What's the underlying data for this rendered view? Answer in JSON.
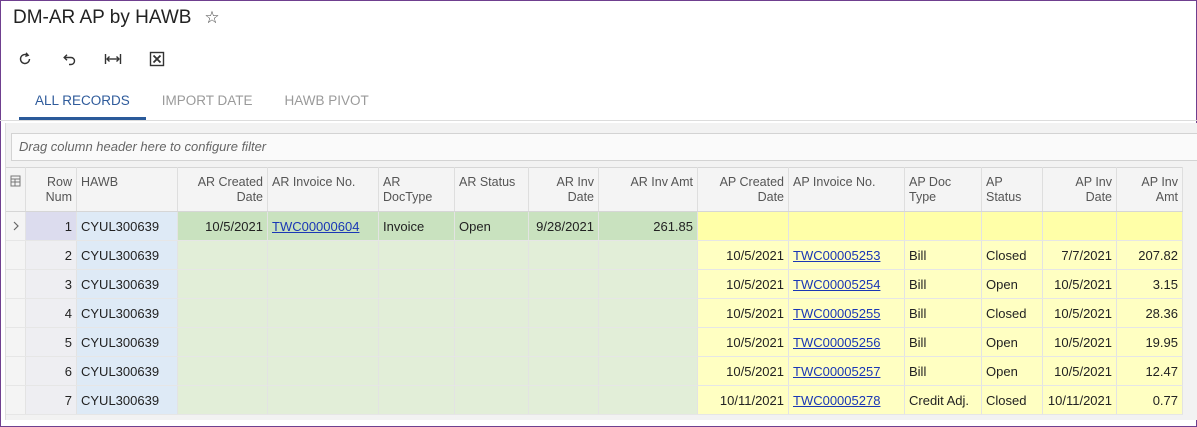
{
  "page": {
    "title": "DM-AR AP by HAWB",
    "favorite_icon": "star-icon"
  },
  "toolbar": {
    "buttons": [
      {
        "name": "refresh-button",
        "icon": "refresh-icon"
      },
      {
        "name": "undo-button",
        "icon": "undo-icon"
      },
      {
        "name": "fit-columns-button",
        "icon": "fit-width-icon"
      },
      {
        "name": "export-excel-button",
        "icon": "excel-icon"
      }
    ]
  },
  "tabs": [
    {
      "label": "ALL RECORDS",
      "active": true
    },
    {
      "label": "IMPORT DATE",
      "active": false
    },
    {
      "label": "HAWB PIVOT",
      "active": false
    }
  ],
  "grid": {
    "filter_placeholder": "Drag column header here to configure filter",
    "columns": {
      "row_num": "Row Num",
      "hawb": "HAWB",
      "ar_created_date": "AR Created Date",
      "ar_invoice_no": "AR Invoice No.",
      "ar_doctype": "AR DocType",
      "ar_status": "AR Status",
      "ar_inv_date": "AR Inv Date",
      "ar_inv_amt": "AR Inv Amt",
      "ap_created_date": "AP Created Date",
      "ap_invoice_no": "AP Invoice No.",
      "ap_doc_type": "AP Doc Type",
      "ap_status": "AP Status",
      "ap_inv_date": "AP Inv Date",
      "ap_inv_amt": "AP Inv Amt"
    },
    "rows": [
      {
        "row_num": "1",
        "hawb": "CYUL300639",
        "ar_created_date": "10/5/2021",
        "ar_invoice_no": "TWC00000604",
        "ar_doctype": "Invoice",
        "ar_status": "Open",
        "ar_inv_date": "9/28/2021",
        "ar_inv_amt": "261.85",
        "ap_created_date": "",
        "ap_invoice_no": "",
        "ap_doc_type": "",
        "ap_status": "",
        "ap_inv_date": "",
        "ap_inv_amt": "",
        "selected": true
      },
      {
        "row_num": "2",
        "hawb": "CYUL300639",
        "ar_created_date": "",
        "ar_invoice_no": "",
        "ar_doctype": "",
        "ar_status": "",
        "ar_inv_date": "",
        "ar_inv_amt": "",
        "ap_created_date": "10/5/2021",
        "ap_invoice_no": "TWC00005253",
        "ap_doc_type": "Bill",
        "ap_status": "Closed",
        "ap_inv_date": "7/7/2021",
        "ap_inv_amt": "207.82"
      },
      {
        "row_num": "3",
        "hawb": "CYUL300639",
        "ar_created_date": "",
        "ar_invoice_no": "",
        "ar_doctype": "",
        "ar_status": "",
        "ar_inv_date": "",
        "ar_inv_amt": "",
        "ap_created_date": "10/5/2021",
        "ap_invoice_no": "TWC00005254",
        "ap_doc_type": "Bill",
        "ap_status": "Open",
        "ap_inv_date": "10/5/2021",
        "ap_inv_amt": "3.15"
      },
      {
        "row_num": "4",
        "hawb": "CYUL300639",
        "ar_created_date": "",
        "ar_invoice_no": "",
        "ar_doctype": "",
        "ar_status": "",
        "ar_inv_date": "",
        "ar_inv_amt": "",
        "ap_created_date": "10/5/2021",
        "ap_invoice_no": "TWC00005255",
        "ap_doc_type": "Bill",
        "ap_status": "Closed",
        "ap_inv_date": "10/5/2021",
        "ap_inv_amt": "28.36"
      },
      {
        "row_num": "5",
        "hawb": "CYUL300639",
        "ar_created_date": "",
        "ar_invoice_no": "",
        "ar_doctype": "",
        "ar_status": "",
        "ar_inv_date": "",
        "ar_inv_amt": "",
        "ap_created_date": "10/5/2021",
        "ap_invoice_no": "TWC00005256",
        "ap_doc_type": "Bill",
        "ap_status": "Open",
        "ap_inv_date": "10/5/2021",
        "ap_inv_amt": "19.95"
      },
      {
        "row_num": "6",
        "hawb": "CYUL300639",
        "ar_created_date": "",
        "ar_invoice_no": "",
        "ar_doctype": "",
        "ar_status": "",
        "ar_inv_date": "",
        "ar_inv_amt": "",
        "ap_created_date": "10/5/2021",
        "ap_invoice_no": "TWC00005257",
        "ap_doc_type": "Bill",
        "ap_status": "Open",
        "ap_inv_date": "10/5/2021",
        "ap_inv_amt": "12.47"
      },
      {
        "row_num": "7",
        "hawb": "CYUL300639",
        "ar_created_date": "",
        "ar_invoice_no": "",
        "ar_doctype": "",
        "ar_status": "",
        "ar_inv_date": "",
        "ar_inv_amt": "",
        "ap_created_date": "10/11/2021",
        "ap_invoice_no": "TWC00005278",
        "ap_doc_type": "Credit Adj.",
        "ap_status": "Closed",
        "ap_inv_date": "10/11/2021",
        "ap_inv_amt": "0.77"
      }
    ]
  }
}
